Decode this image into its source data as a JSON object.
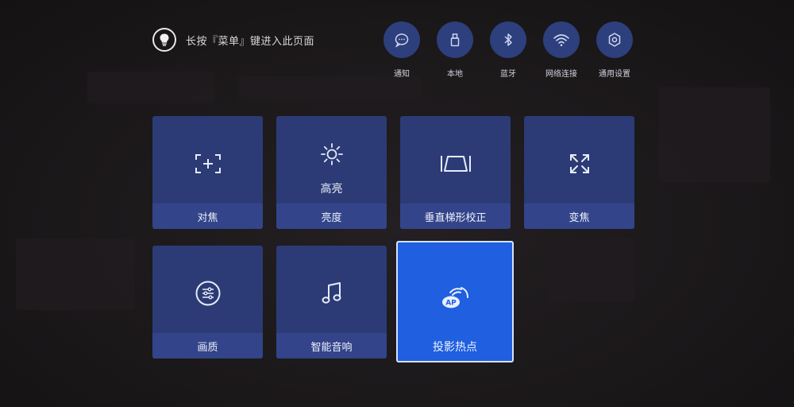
{
  "hint": {
    "icon": "lightbulb-icon",
    "text": "长按『菜单』键进入此页面"
  },
  "quick_actions": [
    {
      "label": "通知",
      "icon": "message-icon"
    },
    {
      "label": "本地",
      "icon": "usb-icon"
    },
    {
      "label": "蓝牙",
      "icon": "bluetooth-icon"
    },
    {
      "label": "网络连接",
      "icon": "wifi-icon"
    },
    {
      "label": "通用设置",
      "icon": "settings-icon"
    }
  ],
  "tiles": [
    {
      "label": "对焦",
      "icon": "focus-icon",
      "value": ""
    },
    {
      "label": "亮度",
      "icon": "brightness-icon",
      "value": "高亮"
    },
    {
      "label": "垂直梯形校正",
      "icon": "keystone-icon",
      "value": ""
    },
    {
      "label": "变焦",
      "icon": "zoom-icon",
      "value": ""
    },
    {
      "label": "画质",
      "icon": "picture-quality-icon",
      "value": ""
    },
    {
      "label": "智能音响",
      "icon": "music-icon",
      "value": ""
    },
    {
      "label": "投影热点",
      "icon": "ap-hotspot-icon",
      "value": "",
      "selected": true,
      "badge": "AP"
    }
  ],
  "colors": {
    "background": "#1a1719",
    "tile": "#2c3b76",
    "tile_bar": "#33448a",
    "selected_tile": "#1f5fe0",
    "quick_circle": "#2d3f7c"
  }
}
